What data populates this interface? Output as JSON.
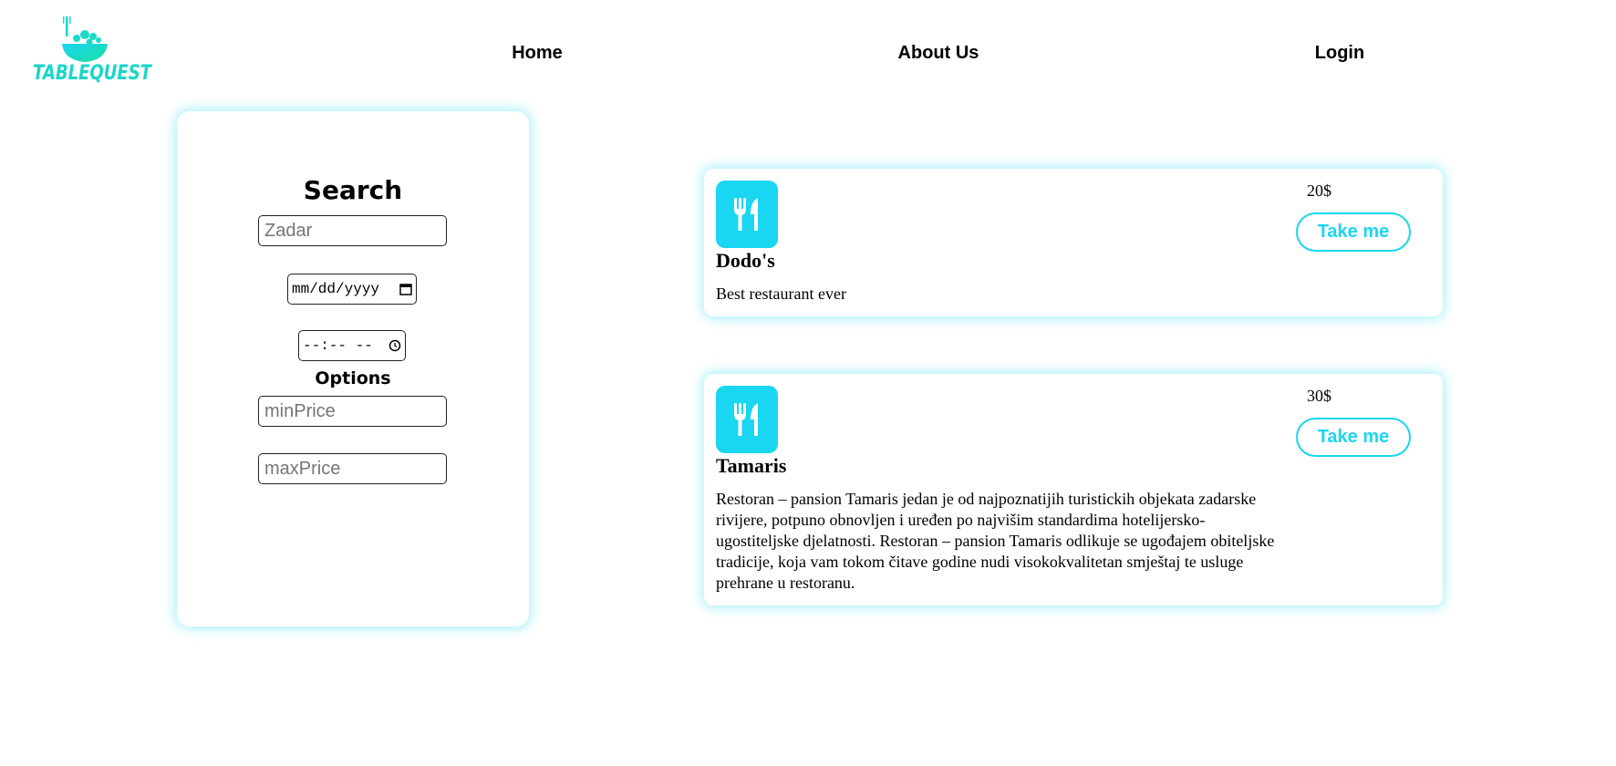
{
  "brand": {
    "name": "TABLEQUEST",
    "color": "#1ad6c8"
  },
  "nav": {
    "home": "Home",
    "about": "About Us",
    "login": "Login"
  },
  "search": {
    "title": "Search",
    "city_placeholder": "Zadar",
    "date_placeholder": "mm/dd/yyyy",
    "time_placeholder": "--:-- --",
    "options_title": "Options",
    "min_price_placeholder": "minPrice",
    "max_price_placeholder": "maxPrice"
  },
  "accent_color": "#1ad6f0",
  "restaurants": [
    {
      "name": "Dodo's",
      "description": "Best restaurant ever",
      "price": "20$",
      "button": "Take me",
      "icon": "fork-knife-icon"
    },
    {
      "name": "Tamaris",
      "description": "Restoran – pansion Tamaris jedan je od najpoznatijih turistickih objekata zadarske rivijere, potpuno obnovljen i uređen po najvišim standardima hotelijersko-ugostiteljske djelatnosti. Restoran – pansion Tamaris odlikuje se ugođajem obiteljske tradicije, koja vam tokom čitave godine nudi visokokvalitetan smještaj te usluge prehrane u restoranu.",
      "price": "30$",
      "button": "Take me",
      "icon": "fork-knife-icon"
    }
  ]
}
